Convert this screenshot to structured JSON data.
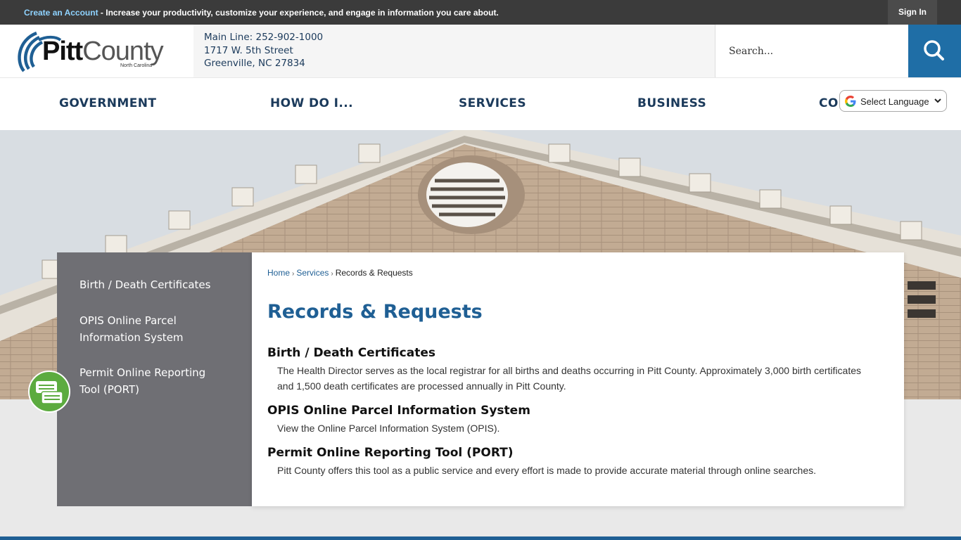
{
  "topbar": {
    "create_account": "Create an Account",
    "message": " - Increase your productivity, customize your experience, and engage in information you care about.",
    "sign_in": "Sign In"
  },
  "logo": {
    "name_bold": "Pitt",
    "name_light": "County",
    "state": "North Carolina"
  },
  "contact": {
    "main_line": "Main Line: 252-902-1000",
    "street": "1717 W. 5th Street",
    "city": "Greenville, NC 27834"
  },
  "search": {
    "placeholder": "Search..."
  },
  "nav": {
    "items": [
      {
        "label": "GOVERNMENT"
      },
      {
        "label": "HOW DO I..."
      },
      {
        "label": "SERVICES"
      },
      {
        "label": "BUSINESS"
      },
      {
        "label": "CO"
      }
    ]
  },
  "translate": {
    "label": "Select Language"
  },
  "sidebar": {
    "items": [
      {
        "line1": "Birth / Death Certificates",
        "line2": ""
      },
      {
        "line1": "OPIS Online Parcel",
        "line2": "Information System"
      },
      {
        "line1": "Permit Online Reporting",
        "line2": "Tool (PORT)"
      }
    ]
  },
  "breadcrumb": {
    "home": "Home",
    "services": "Services",
    "current": "Records & Requests",
    "sep": "›"
  },
  "page": {
    "title": "Records & Requests",
    "sections": [
      {
        "title": "Birth / Death Certificates",
        "desc_line1": "The Health Director serves as the local registrar for all births and deaths occurring in Pitt County. Approximately 3,000 birth certificates",
        "desc_line2": "and 1,500 death certificates are processed annually in Pitt County."
      },
      {
        "title": "OPIS Online Parcel Information System",
        "desc_line1": "View the Online Parcel Information System (OPIS).",
        "desc_line2": ""
      },
      {
        "title": "Permit Online Reporting Tool (PORT)",
        "desc_line1": "Pitt County offers this tool as a public service and every effort is made to provide accurate material through online searches.",
        "desc_line2": ""
      }
    ]
  },
  "colors": {
    "brand_blue": "#1f5f94",
    "topbar": "#3b3b3b",
    "sidebar": "#6f6f74",
    "chat_green": "#5cab3f"
  }
}
